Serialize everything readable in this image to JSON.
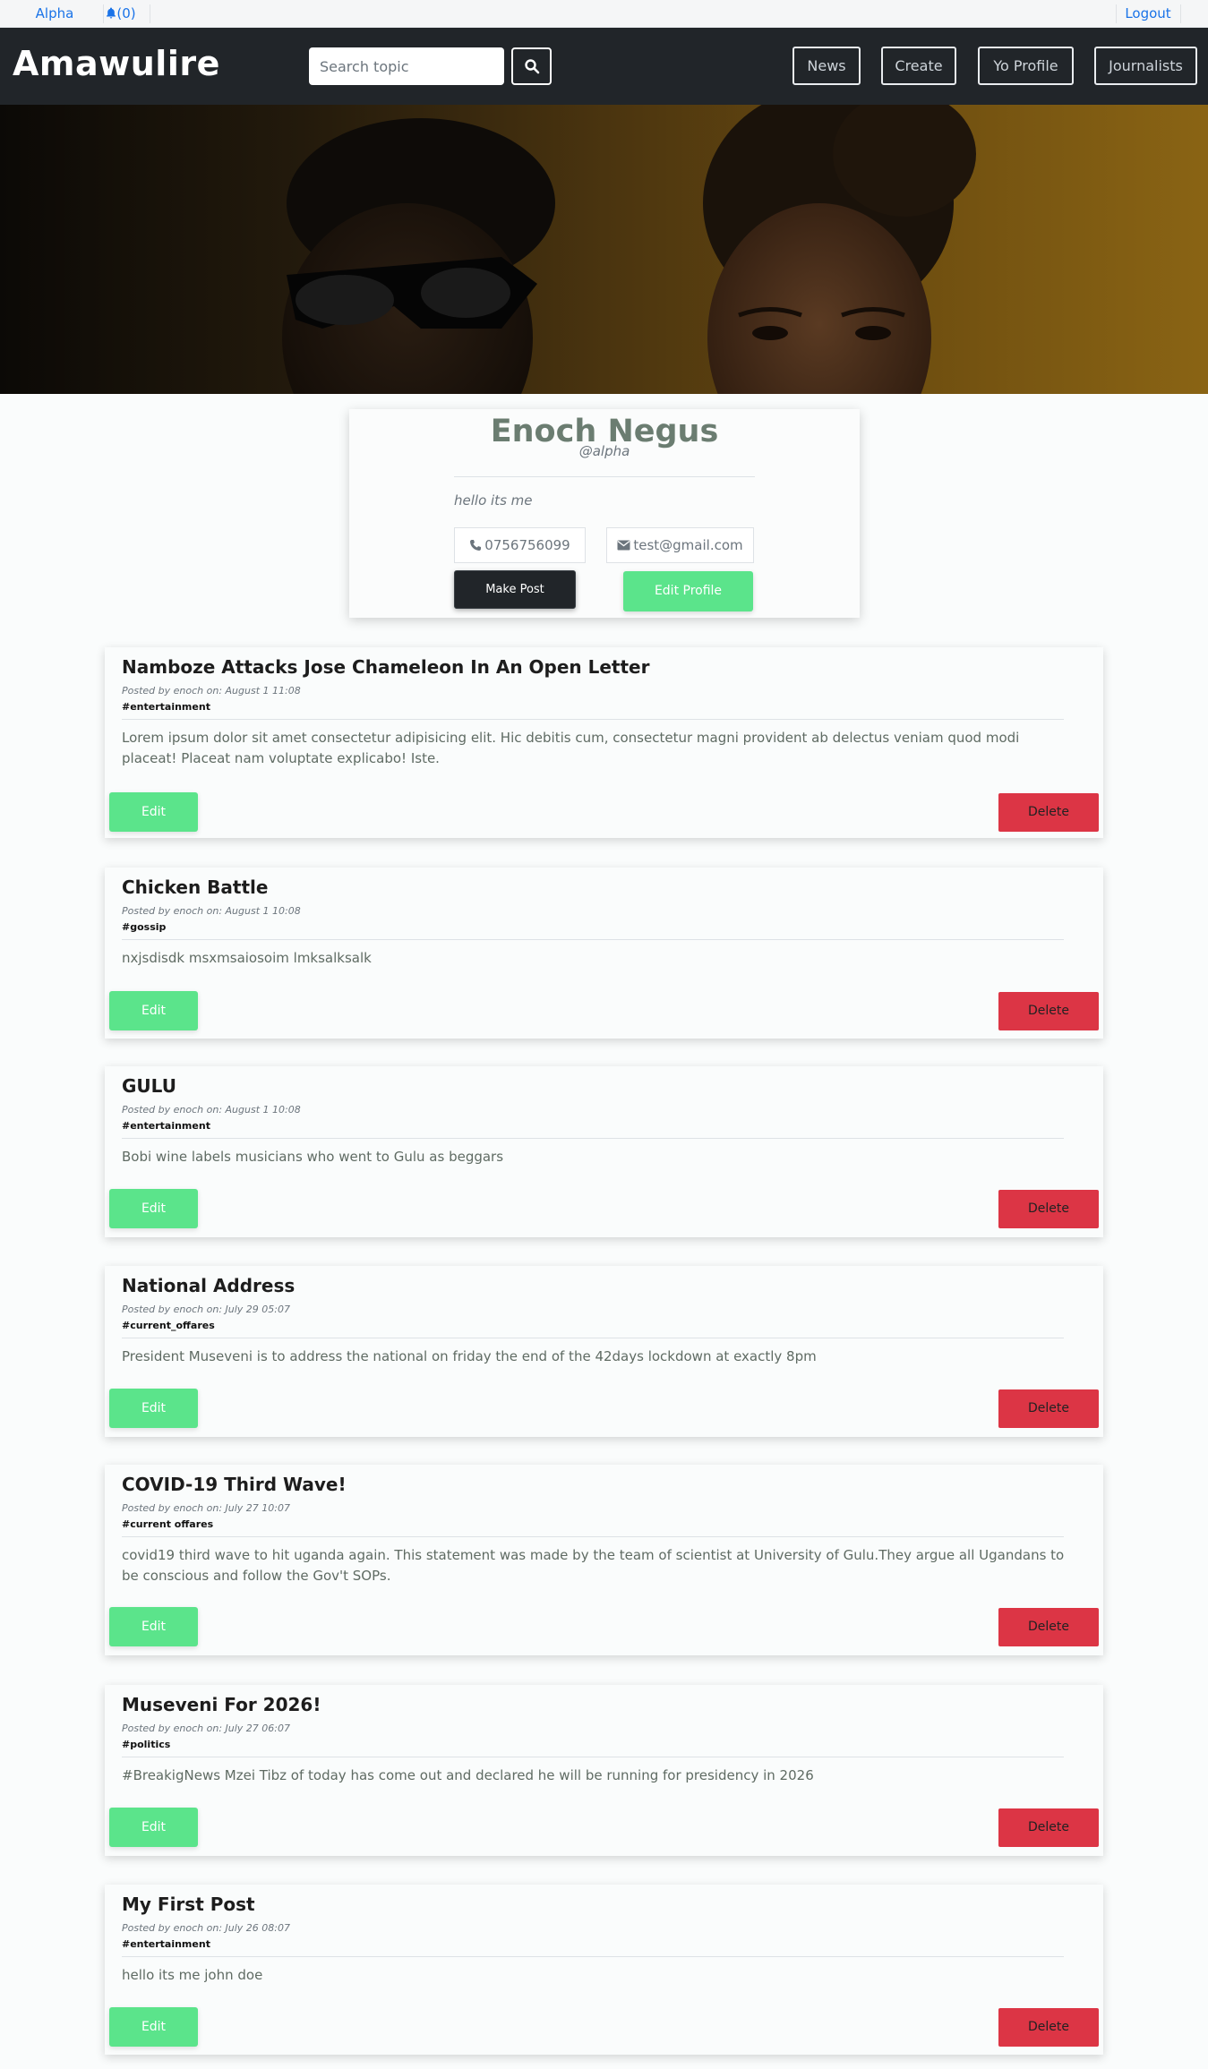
{
  "topbar": {
    "user_link": "Alpha",
    "notifications_label": "(0)",
    "logout_label": "Logout"
  },
  "navbar": {
    "brand": "Amawulire",
    "search_placeholder": "Search topic",
    "links": [
      "News",
      "Create",
      "Yo Profile",
      "Journalists"
    ]
  },
  "profile": {
    "name": "Enoch Negus",
    "handle": "@alpha",
    "bio": "hello its me",
    "phone": "0756756099",
    "email": "test@gmail.com",
    "make_post_label": "Make Post",
    "edit_profile_label": "Edit Profile"
  },
  "posts": [
    {
      "title": "Namboze Attacks Jose Chameleon In An Open Letter",
      "meta": "Posted by enoch on: August 1 11:08",
      "tag": "#entertainment",
      "body": "Lorem ipsum dolor sit amet consectetur adipisicing elit. Hic debitis cum, consectetur magni provident ab delectus veniam quod modi placeat! Placeat nam voluptate explicabo! Iste.",
      "edit_label": "Edit",
      "delete_label": "Delete"
    },
    {
      "title": "Chicken Battle",
      "meta": "Posted by enoch on: August 1 10:08",
      "tag": "#gossip",
      "body": "nxjsdisdk msxmsaiosoim lmksalksalk",
      "edit_label": "Edit",
      "delete_label": "Delete"
    },
    {
      "title": "GULU",
      "meta": "Posted by enoch on: August 1 10:08",
      "tag": "#entertainment",
      "body": "Bobi wine labels musicians who went to Gulu as beggars",
      "edit_label": "Edit",
      "delete_label": "Delete"
    },
    {
      "title": "National Address",
      "meta": "Posted by enoch on: July 29 05:07",
      "tag": "#current_offares",
      "body": "President Museveni is to address the national on friday the end of the 42days lockdown at exactly 8pm",
      "edit_label": "Edit",
      "delete_label": "Delete"
    },
    {
      "title": "COVID-19 Third Wave!",
      "meta": "Posted by enoch on: July 27 10:07",
      "tag": "#current offares",
      "body": "covid19 third wave to hit uganda again. This statement was made by the team of scientist at University of Gulu.They argue all Ugandans to be conscious and follow the Gov't SOPs.",
      "edit_label": "Edit",
      "delete_label": "Delete"
    },
    {
      "title": "Museveni For 2026!",
      "meta": "Posted by enoch on: July 27 06:07",
      "tag": "#politics",
      "body": "#BreakigNews Mzei Tibz of today has come out and declared he will be running for presidency in 2026",
      "edit_label": "Edit",
      "delete_label": "Delete"
    },
    {
      "title": "My First Post",
      "meta": "Posted by enoch on: July 26 08:07",
      "tag": "#entertainment",
      "body": "hello its me john doe",
      "edit_label": "Edit",
      "delete_label": "Delete"
    }
  ]
}
